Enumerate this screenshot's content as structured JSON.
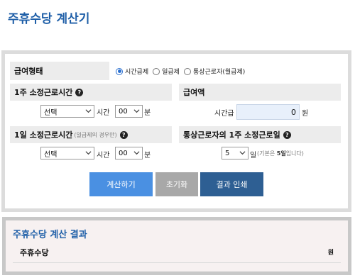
{
  "title": "주휴수당 계산기",
  "pay_type": {
    "label": "급여형태",
    "options": [
      "시간급제",
      "일급제",
      "통상근로자(월급제)"
    ],
    "selected_index": 0
  },
  "weekly_hours": {
    "label": "1주 소정근로시간",
    "help_icon": "question-circle-icon",
    "hour_select": "선택",
    "hour_unit": "시간",
    "minute_select": "00",
    "minute_unit": "분"
  },
  "pay_amount": {
    "label": "급여액",
    "field_label": "시간급",
    "value": "0",
    "unit": "원"
  },
  "daily_hours": {
    "label": "1일 소정근로시간",
    "note": "(일급제의 경우만)",
    "help_icon": "question-circle-icon",
    "hour_select": "선택",
    "hour_unit": "시간",
    "minute_select": "00",
    "minute_unit": "분"
  },
  "work_days": {
    "label": "통상근로자의 1주 소정근로일",
    "help_icon": "question-circle-icon",
    "select": "5",
    "unit": "일",
    "note_prefix": "(기본은 ",
    "note_bold": "5일",
    "note_suffix": "입니다)"
  },
  "buttons": {
    "calculate": "계산하기",
    "reset": "초기화",
    "print": "결과 인쇄"
  },
  "result": {
    "title": "주휴수당 계산 결과",
    "label": "주휴수당",
    "unit": "원"
  },
  "colors": {
    "title": "#1f5fa8",
    "calculate_button": "#4a90e2",
    "reset_button": "#a8a8a8",
    "print_button": "#2e5f93"
  }
}
